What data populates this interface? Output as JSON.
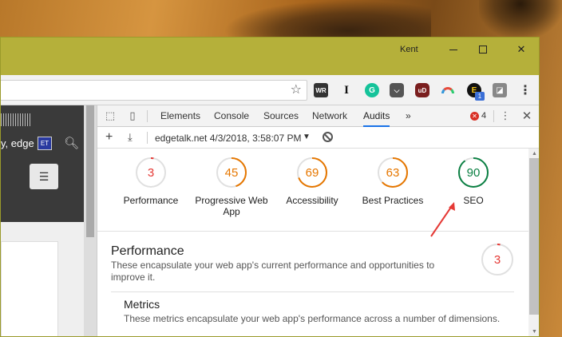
{
  "window": {
    "user": "Kent",
    "colors": {
      "titlebar": "#b5b03a"
    }
  },
  "toolbar": {
    "extensions": [
      {
        "name": "wr-extension",
        "label": "WR"
      },
      {
        "name": "instapaper-extension",
        "label": "I"
      },
      {
        "name": "grammarly-extension",
        "label": "G"
      },
      {
        "name": "pocket-extension",
        "label": ""
      },
      {
        "name": "ublock-extension",
        "label": "uD"
      },
      {
        "name": "rainbow-extension",
        "label": ""
      },
      {
        "name": "e-extension",
        "label": "E",
        "badge": "1"
      },
      {
        "name": "grey-extension",
        "label": ""
      }
    ]
  },
  "page": {
    "tagline": "y, edge",
    "badge": "ET"
  },
  "devtools": {
    "tabs": [
      "Elements",
      "Console",
      "Sources",
      "Network",
      "Audits"
    ],
    "active_tab": "Audits",
    "more": "»",
    "error_count": "4",
    "report_label": "edgetalk.net 4/3/2018, 3:58:07 PM"
  },
  "audits": {
    "scores": [
      {
        "label": "Performance",
        "value": "3",
        "level": 0.03,
        "color": "#e53935"
      },
      {
        "label": "Progressive Web App",
        "value": "45",
        "level": 0.45,
        "color": "#e67700"
      },
      {
        "label": "Accessibility",
        "value": "69",
        "level": 0.69,
        "color": "#e67700"
      },
      {
        "label": "Best Practices",
        "value": "63",
        "level": 0.63,
        "color": "#e67700"
      },
      {
        "label": "SEO",
        "value": "90",
        "level": 0.9,
        "color": "#0b8043"
      }
    ],
    "category": {
      "title": "Performance",
      "description": "These encapsulate your web app's current performance and opportunities to improve it.",
      "score": "3",
      "level": 0.03,
      "color": "#e53935"
    },
    "metrics": {
      "title": "Metrics",
      "description": "These metrics encapsulate your web app's performance across a number of dimensions."
    }
  },
  "annotation_color": "#e53935"
}
